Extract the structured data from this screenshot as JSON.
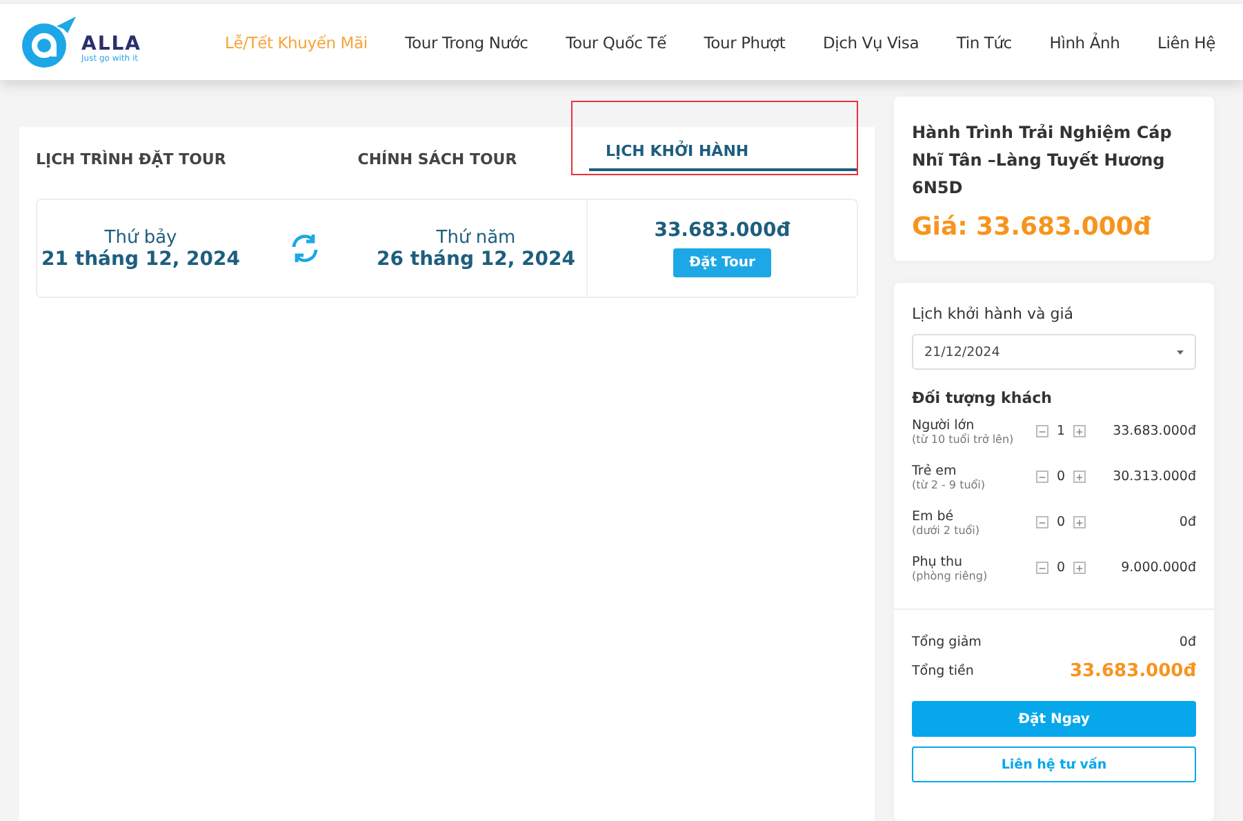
{
  "header": {
    "logo": {
      "name": "ALLA",
      "slogan": "Just go with it"
    },
    "nav": [
      {
        "label": "Lễ/Tết Khuyến Mãi",
        "selected": true
      },
      {
        "label": "Tour Trong Nước",
        "selected": false
      },
      {
        "label": "Tour Quốc Tế",
        "selected": false
      },
      {
        "label": "Tour Phượt",
        "selected": false
      },
      {
        "label": "Dịch Vụ Visa",
        "selected": false
      },
      {
        "label": "Tin Tức",
        "selected": false
      },
      {
        "label": "Hình Ảnh",
        "selected": false
      },
      {
        "label": "Liên Hệ",
        "selected": false
      }
    ]
  },
  "tabs": [
    {
      "label": "LỊCH TRÌNH ĐẶT TOUR",
      "selected": false,
      "highlighted": false
    },
    {
      "label": "CHÍNH SÁCH TOUR",
      "selected": false,
      "highlighted": false
    },
    {
      "label": "LỊCH KHỞI HÀNH",
      "selected": true,
      "highlighted": true
    }
  ],
  "departures": [
    {
      "start_day": "Thứ bảy",
      "start_date": "21 tháng 12, 2024",
      "end_day": "Thứ năm",
      "end_date": "26 tháng 12, 2024",
      "price": "33.683.000đ",
      "button": "Đặt Tour"
    }
  ],
  "summary": {
    "title": "Hành Trình Trải Nghiệm Cáp Nhĩ Tân –Làng Tuyết Hương 6N5D",
    "price": "Giá: 33.683.000đ"
  },
  "booking": {
    "date_label": "Lịch khởi hành và giá",
    "date_value": "21/12/2024",
    "guests_label": "Đối tượng khách",
    "guests": [
      {
        "name": "Người lớn",
        "note": "(từ 10 tuổi trở lên)",
        "minus": "−",
        "count": "1",
        "plus": "+",
        "price": "33.683.000đ"
      },
      {
        "name": "Trẻ em",
        "note": "(từ 2 - 9 tuổi)",
        "minus": "−",
        "count": "0",
        "plus": "+",
        "price": "30.313.000đ"
      },
      {
        "name": "Em bé",
        "note": "(dưới 2 tuổi)",
        "minus": "−",
        "count": "0",
        "plus": "+",
        "price": "0đ"
      },
      {
        "name": "Phụ thu",
        "note": "(phòng riêng)",
        "minus": "−",
        "count": "0",
        "plus": "+",
        "price": "9.000.000đ"
      }
    ],
    "discount_label": "Tổng giảm",
    "discount": "0đ",
    "total_label": "Tổng tiền",
    "total": "33.683.000đ",
    "book_button": "Đặt Ngay",
    "contact_button": "Liên hệ tư vấn"
  }
}
